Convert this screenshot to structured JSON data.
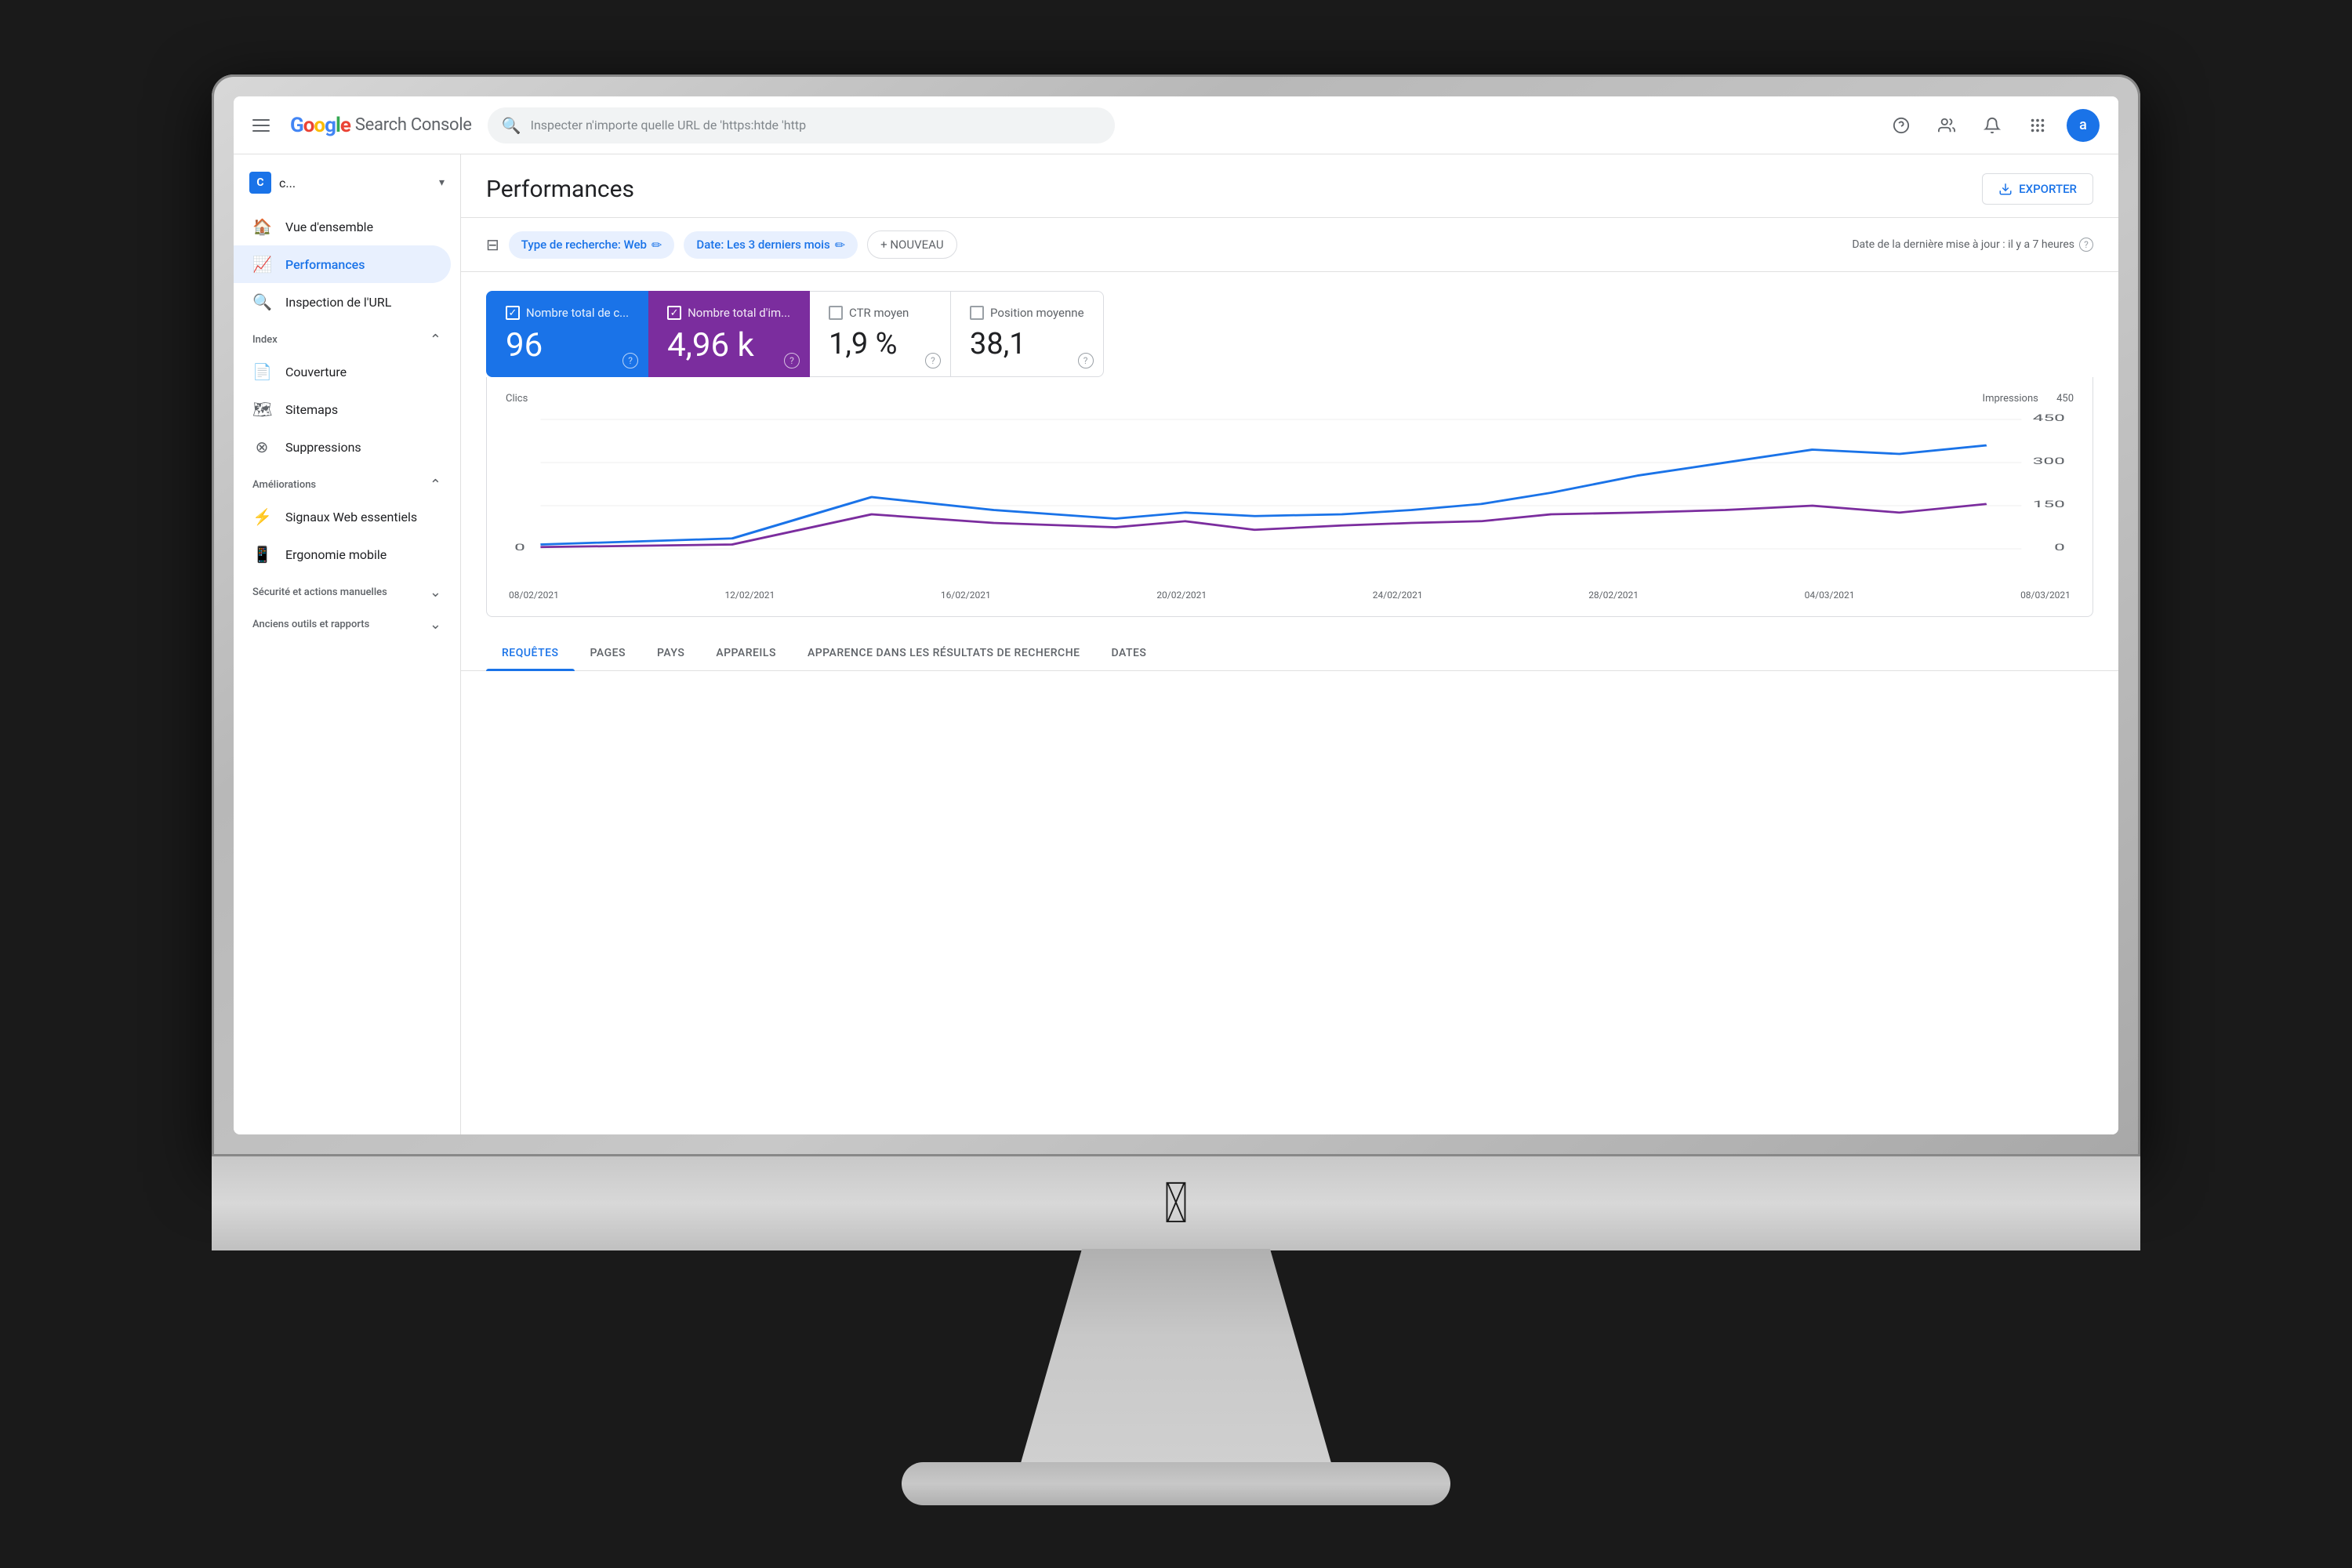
{
  "app": {
    "title": "Google Search Console",
    "logo_text": "Search Console",
    "search_placeholder": "Inspecter n'importe quelle URL de 'https:htde 'http",
    "avatar_letter": "a"
  },
  "sidebar": {
    "site_name": "c...",
    "nav_items": [
      {
        "id": "overview",
        "label": "Vue d'ensemble",
        "icon": "🏠",
        "active": false
      },
      {
        "id": "performances",
        "label": "Performances",
        "icon": "📈",
        "active": true
      },
      {
        "id": "url-inspection",
        "label": "Inspection de l'URL",
        "icon": "🔍",
        "active": false
      }
    ],
    "index_section": "Index",
    "index_items": [
      {
        "id": "couverture",
        "label": "Couverture",
        "icon": "📄"
      },
      {
        "id": "sitemaps",
        "label": "Sitemaps",
        "icon": "🗺"
      },
      {
        "id": "suppressions",
        "label": "Suppressions",
        "icon": "🚫"
      }
    ],
    "ameliorations_section": "Améliorations",
    "ameliorations_items": [
      {
        "id": "signaux-web",
        "label": "Signaux Web essentiels",
        "icon": "⚡"
      },
      {
        "id": "ergonomie",
        "label": "Ergonomie mobile",
        "icon": "📱"
      }
    ],
    "securite_section": "Sécurité et actions manuelles",
    "anciens_section": "Anciens outils et rapports"
  },
  "page": {
    "title": "Performances",
    "export_label": "EXPORTER"
  },
  "filters": {
    "icon": "⊟",
    "type_chip": "Type de recherche: Web",
    "date_chip": "Date: Les 3 derniers mois",
    "new_button": "+ NOUVEAU",
    "last_update": "Date de la dernière mise à jour : il y a 7 heures"
  },
  "metrics": [
    {
      "id": "clics",
      "label": "Nombre total de c...",
      "value": "96",
      "active": true,
      "style": "blue",
      "checked": true
    },
    {
      "id": "impressions",
      "label": "Nombre total d'im...",
      "value": "4,96 k",
      "active": true,
      "style": "purple",
      "checked": true
    },
    {
      "id": "ctr",
      "label": "CTR moyen",
      "value": "1,9 %",
      "active": false,
      "style": "neutral",
      "checked": false
    },
    {
      "id": "position",
      "label": "Position moyenne",
      "value": "38,1",
      "active": false,
      "style": "neutral",
      "checked": false
    }
  ],
  "chart": {
    "left_label": "Clics",
    "right_label": "Impressions",
    "right_values": [
      "450",
      "300",
      "150",
      "0"
    ],
    "left_values": [
      "",
      ""
    ],
    "x_labels": [
      "08/02/2021",
      "12/02/2021",
      "16/02/2021",
      "20/02/2021",
      "24/02/2021",
      "28/02/2021",
      "04/03/2021",
      "08/03/2021"
    ]
  },
  "tabs": [
    {
      "id": "requetes",
      "label": "REQUÊTES",
      "active": true
    },
    {
      "id": "pages",
      "label": "PAGES",
      "active": false
    },
    {
      "id": "pays",
      "label": "PAYS",
      "active": false
    },
    {
      "id": "appareils",
      "label": "APPAREILS",
      "active": false
    },
    {
      "id": "apparence",
      "label": "APPARENCE DANS LES RÉSULTATS DE RECHERCHE",
      "active": false
    },
    {
      "id": "dates",
      "label": "DATES",
      "active": false
    }
  ]
}
